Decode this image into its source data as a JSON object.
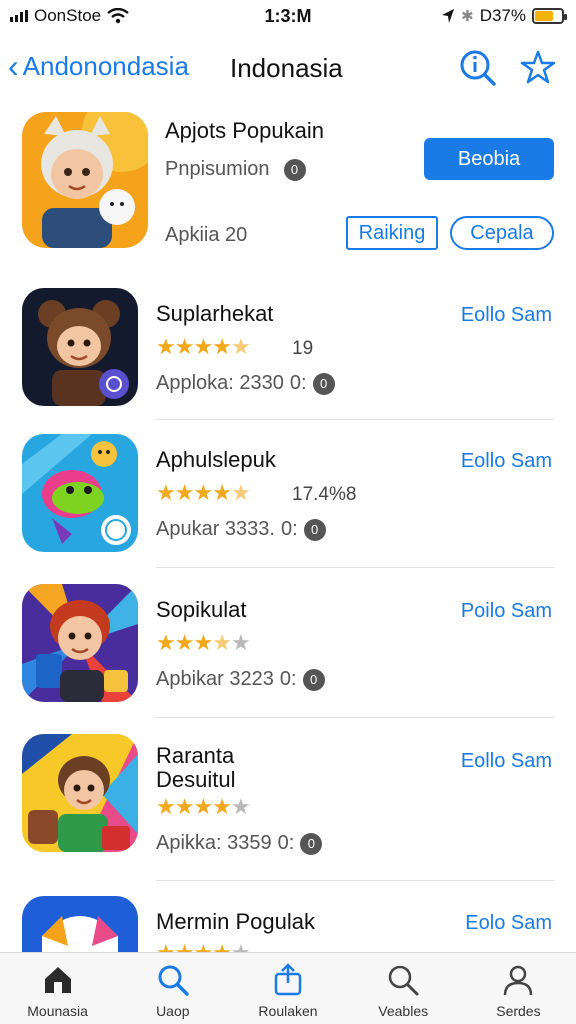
{
  "status_bar": {
    "carrier": "OonStoe",
    "time": "1:3:M",
    "battery": "D37%",
    "battery_level": 0.7
  },
  "nav": {
    "back_label": "Andonondasia",
    "title": "Indonasia",
    "icons": [
      "info-search-icon",
      "star-badge-icon"
    ]
  },
  "featured": {
    "title": "Apjots Popukain",
    "subtitle": "Pnpisumion",
    "subtitle_badge": "0",
    "meta": "Apkiia 20",
    "primary_button": "Beobia",
    "ranking_button": "Raiking",
    "cepat_button": "Cepala"
  },
  "apps": [
    {
      "name": "Suplarhekat",
      "rating": 4.5,
      "rating_count": "19",
      "meta_text": "Apploka: 2330",
      "meta_suffix": "0:",
      "meta_badge": "0",
      "action": "Eollo Sam"
    },
    {
      "name": "Aphulslepuk",
      "rating": 4.5,
      "rating_count": "17.4%8",
      "meta_text": "Apukar 3333.",
      "meta_suffix": "0:",
      "meta_badge": "0",
      "action": "Eollo Sam"
    },
    {
      "name": "Sopikulat",
      "rating": 3.5,
      "rating_count": "",
      "meta_text": "Apbikar 3223",
      "meta_suffix": "0:",
      "meta_badge": "0",
      "action": "Poilo Sam"
    },
    {
      "name": "Raranta\nDesuitul",
      "rating": 4,
      "rating_count": "",
      "meta_text": "Apikka: 3359",
      "meta_suffix": "0:",
      "meta_badge": "0",
      "action": "Eollo Sam"
    },
    {
      "name": "Mermin Pogulak",
      "rating": 4,
      "rating_count": "",
      "meta_text": "",
      "meta_suffix": "",
      "meta_badge": "",
      "action": "Eolo Sam"
    }
  ],
  "tabs": [
    {
      "label": "Mounasia",
      "icon": "home-icon"
    },
    {
      "label": "Uaop",
      "icon": "search-icon"
    },
    {
      "label": "Roulaken",
      "icon": "share-icon"
    },
    {
      "label": "Veables",
      "icon": "search-icon"
    },
    {
      "label": "Serdes",
      "icon": "person-icon"
    }
  ],
  "colors": {
    "accent": "#1a7ae6",
    "star": "#f2a81d",
    "battery": "#f0b400"
  }
}
